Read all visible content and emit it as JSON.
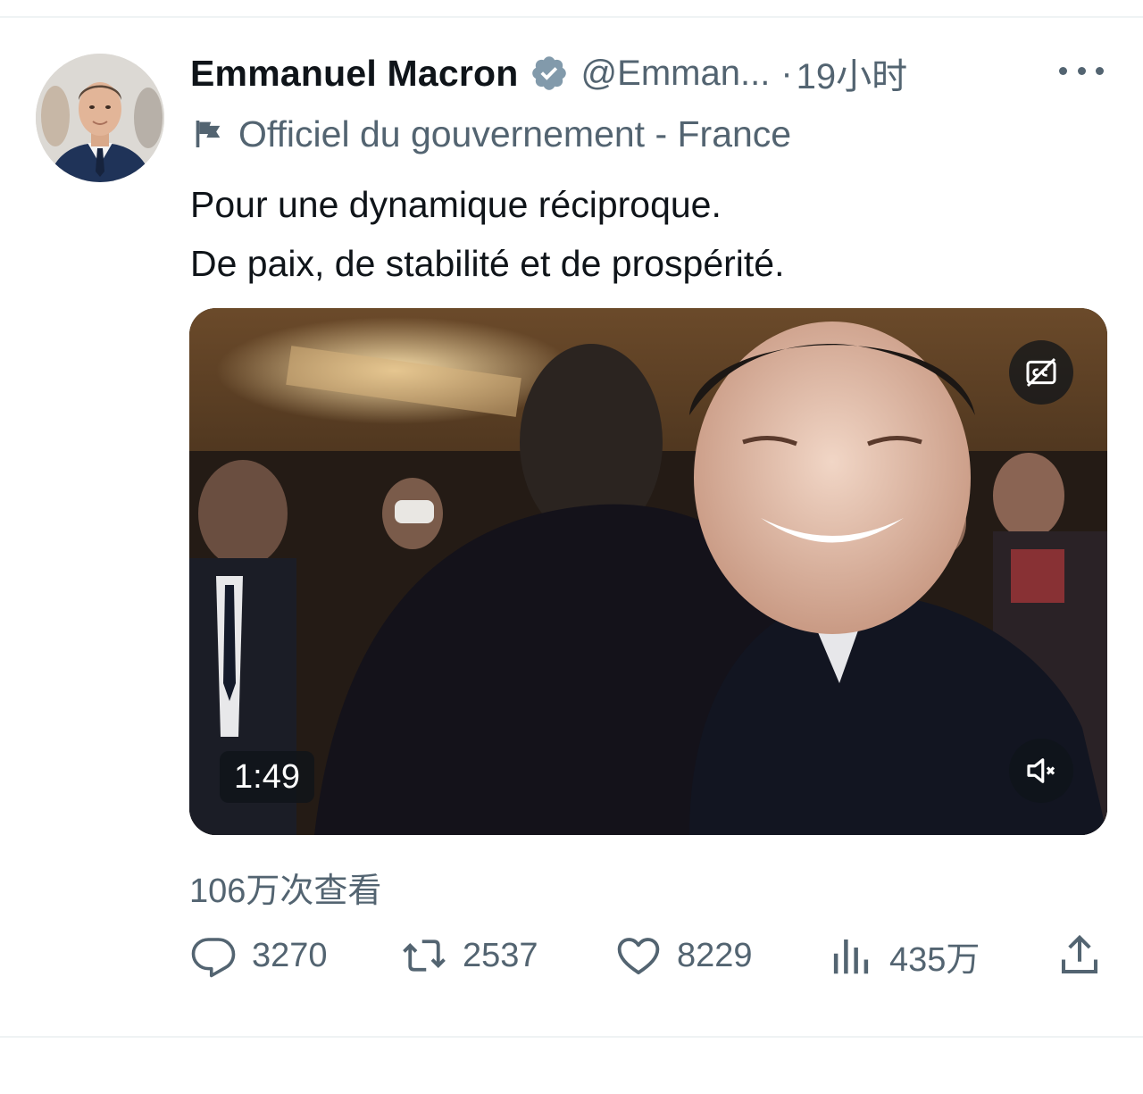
{
  "tweet": {
    "author": {
      "display_name": "Emmanuel Macron",
      "handle": "@Emman...",
      "verified": true,
      "avatar_icon": "avatar-photo"
    },
    "separator": "·",
    "time": "19小时",
    "more_icon": "more-horizontal-icon",
    "label": {
      "icon": "flag-icon",
      "text": "Officiel du gouvernement - France"
    },
    "text_lines": [
      "Pour une dynamique réciproque.",
      "De paix, de stabilité et de prospérité."
    ],
    "media": {
      "type": "video",
      "duration": "1:49",
      "captions_icon": "captions-off-icon",
      "mute_icon": "speaker-muted-icon"
    },
    "views_label": "106万次查看",
    "actions": {
      "reply": {
        "icon": "reply-icon",
        "count": "3270"
      },
      "retweet": {
        "icon": "retweet-icon",
        "count": "2537"
      },
      "like": {
        "icon": "heart-icon",
        "count": "8229"
      },
      "views": {
        "icon": "analytics-icon",
        "count": "435万"
      },
      "share": {
        "icon": "share-icon"
      }
    }
  },
  "colors": {
    "text_primary": "#0f1419",
    "text_secondary": "#536471",
    "verified_badge": "#829aab",
    "divider": "#eff3f4"
  }
}
